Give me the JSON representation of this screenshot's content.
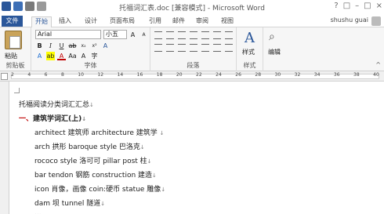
{
  "window": {
    "title": "托福词汇表.doc [兼容模式] - Microsoft Word",
    "controls": [
      "?",
      "□",
      "–",
      "□",
      "×"
    ]
  },
  "tabs": {
    "file": "文件",
    "items": [
      "开始",
      "插入",
      "设计",
      "页面布局",
      "引用",
      "邮件",
      "审阅",
      "视图"
    ],
    "user": "shushu guai"
  },
  "ribbon": {
    "paste_label": "粘贴",
    "font_name": "Arial",
    "font_size": "小五",
    "styles_label": "样式",
    "edit_label": "编辑",
    "groups": {
      "clipboard": "剪贴板",
      "font": "字体",
      "paragraph": "段落",
      "styles": "样式"
    }
  },
  "ruler": {
    "numbers": [
      "2",
      "4",
      "6",
      "8",
      "10",
      "12",
      "14",
      "16",
      "18",
      "20",
      "22",
      "24",
      "26",
      "28",
      "30",
      "32",
      "34",
      "36",
      "38",
      "40"
    ]
  },
  "document": {
    "title_line": "托福阅读分类词汇汇总",
    "heading_num": "一、",
    "heading_text": "建筑学词汇(上)",
    "lines": [
      "architect  建筑师    architecture  建筑学",
      "arch  拱形    baroque style  巴洛克",
      "rococo style  洛可可     pillar post  柱",
      "bar tendon  钢筋    construction  建造",
      "icon 肖像，画像 coin:硬币    statue  雕像",
      "dam  坝     tunnel  隧道",
      "..."
    ],
    "paragraph_mark": "↓"
  },
  "colors": {
    "accent": "#2b579a",
    "heading_number": "#c00000"
  }
}
